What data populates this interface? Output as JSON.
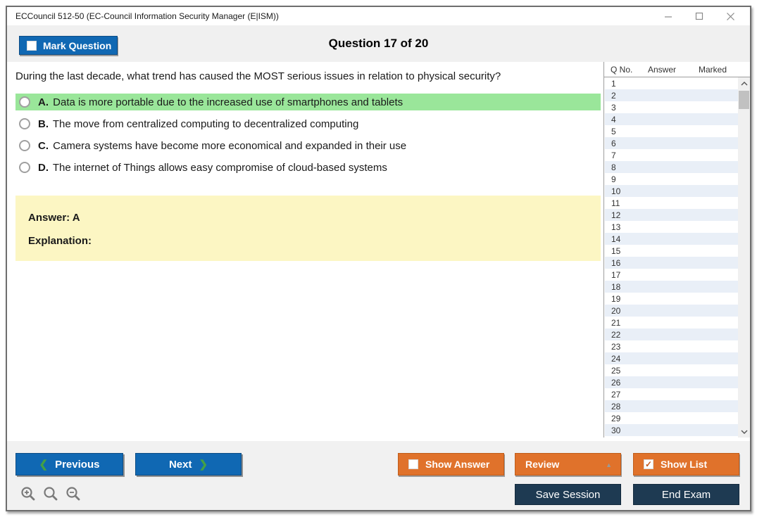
{
  "window": {
    "title": "ECCouncil 512-50 (EC-Council Information Security Manager (E|ISM))"
  },
  "header": {
    "mark_question_label": "Mark Question",
    "question_counter": "Question 17 of 20"
  },
  "question": {
    "text": "During the last decade, what trend has caused the MOST serious issues in relation to physical security?",
    "options": [
      {
        "letter": "A.",
        "text": "Data is more portable due to the increased use of smartphones and tablets",
        "highlighted": true
      },
      {
        "letter": "B.",
        "text": "The move from centralized computing to decentralized computing",
        "highlighted": false
      },
      {
        "letter": "C.",
        "text": "Camera systems have become more economical and expanded in their use",
        "highlighted": false
      },
      {
        "letter": "D.",
        "text": "The internet of Things allows easy compromise of cloud-based systems",
        "highlighted": false
      }
    ]
  },
  "answer_panel": {
    "answer_label": "Answer: A",
    "explanation_label": "Explanation:"
  },
  "question_list": {
    "columns": [
      "Q No.",
      "Answer",
      "Marked"
    ],
    "visible_rows": [
      "1",
      "2",
      "3",
      "4",
      "5",
      "6",
      "7",
      "8",
      "9",
      "10",
      "11",
      "12",
      "13",
      "14",
      "15",
      "16",
      "17",
      "18",
      "19",
      "20",
      "21",
      "22",
      "23",
      "24",
      "25",
      "26",
      "27",
      "28",
      "29",
      "30"
    ]
  },
  "footer": {
    "previous_label": "Previous",
    "next_label": "Next",
    "show_answer_label": "Show Answer",
    "review_label": "Review",
    "show_list_label": "Show List",
    "save_session_label": "Save Session",
    "end_exam_label": "End Exam",
    "show_list_checked": "✓"
  },
  "colors": {
    "accent_blue": "#1068b3",
    "accent_orange": "#e0722b",
    "accent_navy": "#1e3a52",
    "highlight_green": "#9ae69a",
    "answer_yellow": "#fcf6c3",
    "alt_row_blue": "#e9eff7",
    "chevron_green": "#43a047"
  }
}
